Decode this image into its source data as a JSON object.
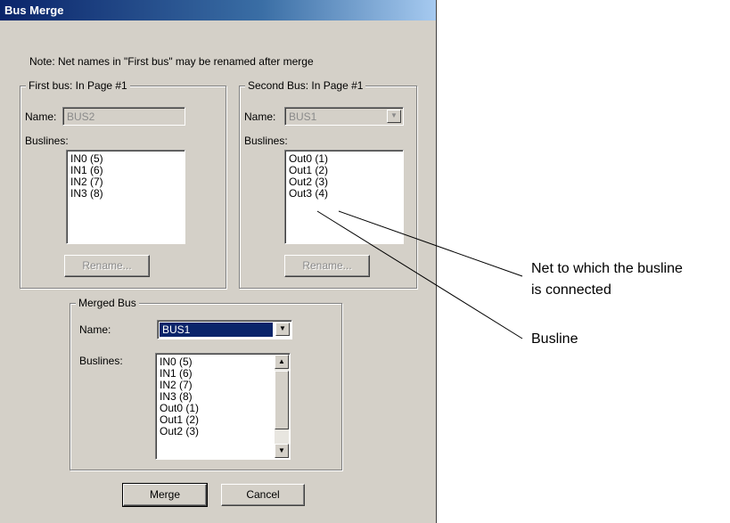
{
  "window": {
    "title": "Bus Merge"
  },
  "note": "Note: Net names in \"First bus\" may be renamed after merge",
  "first_bus": {
    "legend": "First bus: In Page #1",
    "name_label": "Name:",
    "name_value": "BUS2",
    "buslines_label": "Buslines:",
    "buslines": [
      "IN0 (5)",
      "IN1 (6)",
      "IN2 (7)",
      "IN3 (8)"
    ],
    "rename_label": "Rename..."
  },
  "second_bus": {
    "legend": "Second Bus: In Page #1",
    "name_label": "Name:",
    "name_value": "BUS1",
    "buslines_label": "Buslines:",
    "buslines": [
      "Out0 (1)",
      "Out1 (2)",
      "Out2 (3)",
      "Out3 (4)"
    ],
    "rename_label": "Rename..."
  },
  "merged_bus": {
    "legend": "Merged Bus",
    "name_label": "Name:",
    "name_value": "BUS1",
    "buslines_label": "Buslines:",
    "buslines": [
      "IN0 (5)",
      "IN1 (6)",
      "IN2 (7)",
      "IN3 (8)",
      "Out0 (1)",
      "Out1 (2)",
      "Out2 (3)"
    ]
  },
  "buttons": {
    "merge": "Merge",
    "cancel": "Cancel"
  },
  "icons": {
    "dropdown": "chevron-down-icon",
    "scroll_up": "scroll-up-arrow-icon",
    "scroll_down": "scroll-down-arrow-icon"
  },
  "callouts": {
    "net": [
      "Net to which the busline",
      "is connected"
    ],
    "busline": "Busline"
  }
}
